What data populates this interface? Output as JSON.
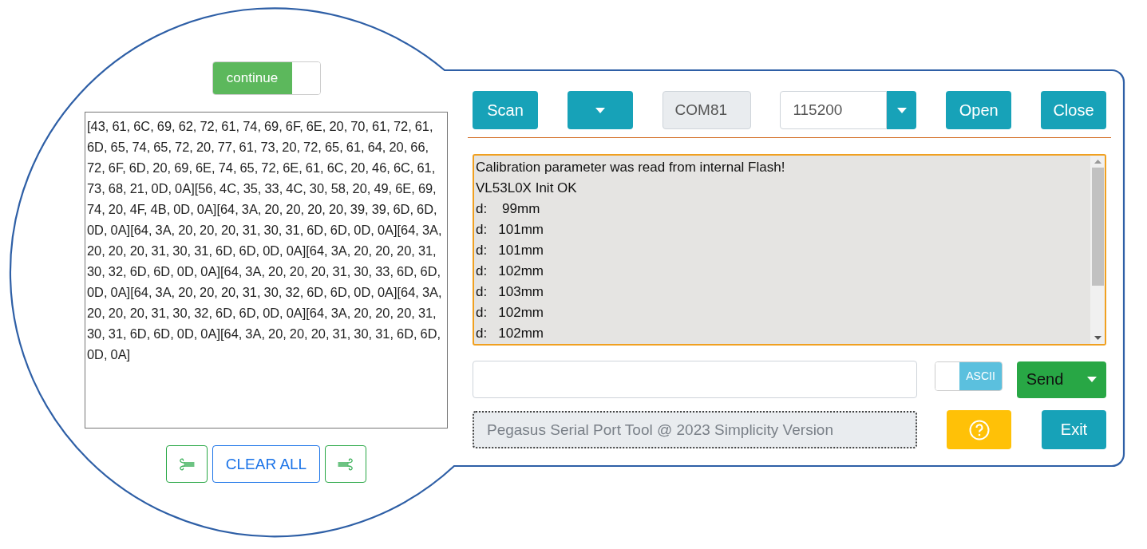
{
  "continue_toggle": {
    "label": "continue",
    "on": true
  },
  "hex_output": {
    "text": "[43, 61, 6C, 69, 62, 72, 61, 74, 69, 6F, 6E, 20, 70, 61, 72, 61, 6D, 65, 74, 65, 72, 20, 77, 61, 73, 20, 72, 65, 61, 64, 20, 66, 72, 6F, 6D, 20, 69, 6E, 74, 65, 72, 6E, 61, 6C, 20, 46, 6C, 61, 73, 68, 21, 0D, 0A][56, 4C, 35, 33, 4C, 30, 58, 20, 49, 6E, 69, 74, 20, 4F, 4B, 0D, 0A][64, 3A, 20, 20, 20, 20, 39, 39, 6D, 6D, 0D, 0A][64, 3A, 20, 20, 20, 31, 30, 31, 6D, 6D, 0D, 0A][64, 3A, 20, 20, 20, 31, 30, 31, 6D, 6D, 0D, 0A][64, 3A, 20, 20, 20, 31, 30, 32, 6D, 6D, 0D, 0A][64, 3A, 20, 20, 20, 31, 30, 33, 6D, 6D, 0D, 0A][64, 3A, 20, 20, 20, 31, 30, 32, 6D, 6D, 0D, 0A][64, 3A, 20, 20, 20, 31, 30, 32, 6D, 6D, 0D, 0A][64, 3A, 20, 20, 20, 31, 30, 31, 6D, 6D, 0D, 0A][64, 3A, 20, 20, 20, 31, 30, 31, 6D, 6D, 0D, 0A]"
  },
  "clear_all_button": "CLEAR ALL",
  "toolbar": {
    "scan_button": "Scan",
    "port_field": "COM81",
    "baud_field": "115200",
    "open_button": "Open",
    "close_button": "Close"
  },
  "log": {
    "lines": [
      "Calibration parameter was read from internal Flash!",
      "VL53L0X Init OK",
      "d:    99mm",
      "d:   101mm",
      "d:   101mm",
      "d:   102mm",
      "d:   103mm",
      "d:   102mm",
      "d:   102mm"
    ]
  },
  "format_toggle": {
    "label": "ASCII",
    "on": false
  },
  "send_button": "Send",
  "status_field": {
    "placeholder": "Pegasus Serial Port Tool @ 2023 Simplicity Version"
  },
  "exit_button": "Exit"
}
